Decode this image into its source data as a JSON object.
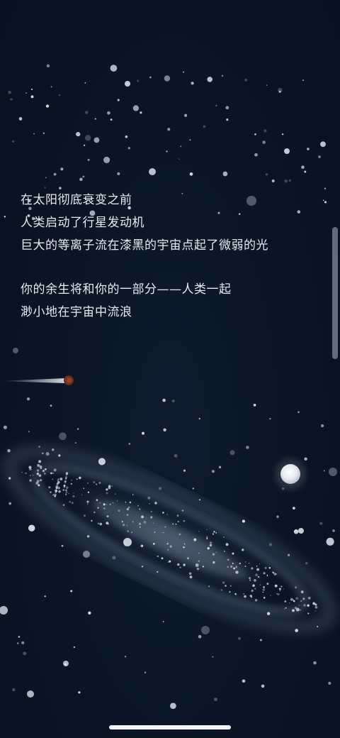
{
  "poem": {
    "stanza1": {
      "line1": "在太阳彻底衰变之前",
      "line2": "人类启动了行星发动机",
      "line3": "巨大的等离子流在漆黑的宇宙点起了微弱的光"
    },
    "stanza2": {
      "line1": "你的余生将和你的一部分——人类一起",
      "line2": "渺小地在宇宙中流浪"
    }
  },
  "colors": {
    "background": "#0b1526",
    "text": "#e6ebf2",
    "star": "#d8dee8",
    "comet_head": "#8a3a22"
  },
  "decor": {
    "background_icon": "starfield-galaxy",
    "comet_icon": "comet-icon",
    "planet_icon": "planet-icon"
  }
}
